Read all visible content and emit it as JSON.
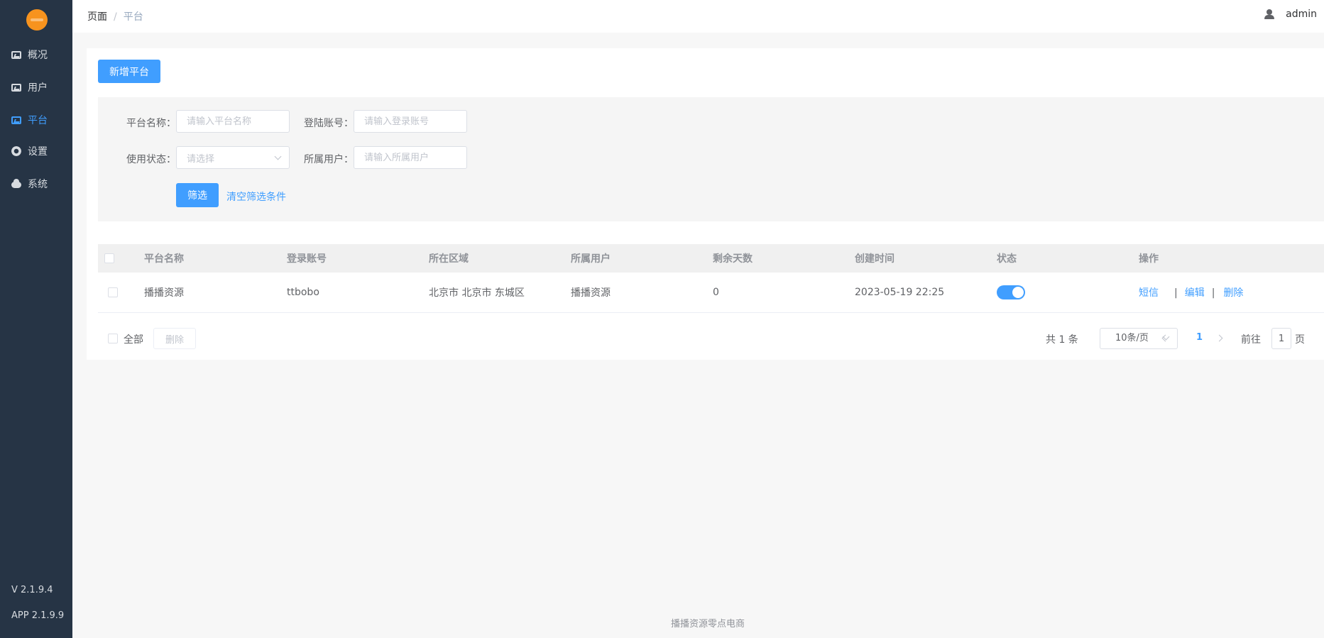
{
  "sidebar": {
    "items": [
      {
        "label": "概况",
        "icon": "screen-icon"
      },
      {
        "label": "用户",
        "icon": "screen-icon"
      },
      {
        "label": "平台",
        "icon": "screen-icon",
        "active": true
      },
      {
        "label": "设置",
        "icon": "gear-icon"
      },
      {
        "label": "系统",
        "icon": "cloud-icon"
      }
    ],
    "version": "V 2.1.9.4",
    "app_version": "APP 2.1.9.9"
  },
  "header": {
    "breadcrumb": [
      "页面",
      "平台"
    ],
    "breadcrumb_separator": "/",
    "user": "admin"
  },
  "toolbar": {
    "add_label": "新增平台"
  },
  "filters": {
    "name_label": "平台名称：",
    "name_placeholder": "请输入平台名称",
    "account_label": "登陆账号：",
    "account_placeholder": "请输入登录账号",
    "status_label": "使用状态：",
    "status_placeholder": "请选择",
    "owner_label": "所属用户：",
    "owner_placeholder": "请输入所属用户",
    "filter_button": "筛选",
    "clear_link": "清空筛选条件"
  },
  "table": {
    "columns": [
      "平台名称",
      "登录账号",
      "所在区域",
      "所属用户",
      "剩余天数",
      "创建时间",
      "状态",
      "操作"
    ],
    "rows": [
      {
        "name": "播播资源",
        "account": "ttbobo",
        "region": "北京市 北京市 东城区",
        "owner": "播播资源",
        "days_left": "0",
        "created": "2023-05-19 22:25",
        "status_on": true,
        "actions": [
          "短信",
          "编辑",
          "删除"
        ],
        "action_separator": "|"
      }
    ]
  },
  "bulk": {
    "select_all": "全部",
    "delete": "删除"
  },
  "pagination": {
    "total": "共 1 条",
    "page_size": "10条/页",
    "current_page": "1",
    "goto_prefix": "前往",
    "goto_value": "1",
    "goto_suffix": "页"
  },
  "footer": {
    "text": "播播资源零点电商"
  },
  "colors": {
    "sidebar_bg": "#263445",
    "accent": "#409eff"
  }
}
